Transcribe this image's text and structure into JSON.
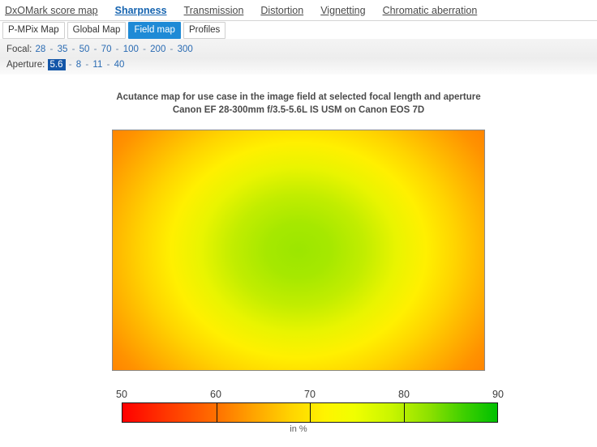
{
  "top_nav": {
    "items": [
      {
        "label": "DxOMark score map",
        "active": false
      },
      {
        "label": "Sharpness",
        "active": true
      },
      {
        "label": "Transmission",
        "active": false
      },
      {
        "label": "Distortion",
        "active": false
      },
      {
        "label": "Vignetting",
        "active": false
      },
      {
        "label": "Chromatic aberration",
        "active": false
      }
    ]
  },
  "subtabs": {
    "items": [
      {
        "label": "P-MPix Map",
        "selected": false
      },
      {
        "label": "Global Map",
        "selected": false
      },
      {
        "label": "Field map",
        "selected": true
      },
      {
        "label": "Profiles",
        "selected": false
      }
    ]
  },
  "parameters": {
    "focal": {
      "label": "Focal:",
      "values": [
        "28",
        "35",
        "50",
        "70",
        "100",
        "200",
        "300"
      ],
      "selected": null
    },
    "aperture": {
      "label": "Aperture:",
      "values": [
        "5.6",
        "8",
        "11",
        "40"
      ],
      "selected": "5.6"
    },
    "separator": "-"
  },
  "chart": {
    "title_line1": "Acutance map for use case in the image field at selected focal length and aperture",
    "title_line2": "Canon EF 28-300mm f/3.5-5.6L IS USM on Canon EOS 7D",
    "unit_label": "in %"
  },
  "colors": {
    "accent_blue": "#1e8ad6",
    "link_blue": "#2a6bb3",
    "selected_blue": "#1356a8",
    "scale_low": "#ff0000",
    "scale_mid": "#fff400",
    "scale_high": "#00c000"
  },
  "chart_data": {
    "type": "heatmap",
    "title": "Acutance map for use case in the image field at selected focal length and aperture",
    "subtitle": "Canon EF 28-300mm f/3.5-5.6L IS USM on Canon EOS 7D",
    "xlabel": "",
    "ylabel": "",
    "unit": "%",
    "colorbar": {
      "label": "in %",
      "min": 50,
      "max": 90,
      "ticks": [
        50,
        60,
        70,
        80,
        90
      ],
      "tick_labels": [
        "50",
        "60",
        "70",
        "80",
        "90"
      ],
      "stops": [
        {
          "value": 50,
          "color": "#ff0000"
        },
        {
          "value": 60,
          "color": "#ff9000"
        },
        {
          "value": 70,
          "color": "#fff400"
        },
        {
          "value": 80,
          "color": "#8ce000"
        },
        {
          "value": 90,
          "color": "#00c000"
        }
      ]
    },
    "field_shape": "radial",
    "center_value": 79,
    "edge_value": 68,
    "corner_value": 63,
    "grid": false,
    "legend_position": "bottom",
    "sampled_values": {
      "center": 79,
      "top_center": 70,
      "bottom_center": 70,
      "left_center": 69,
      "right_center": 69,
      "top_left_corner": 63,
      "top_right_corner": 63,
      "bottom_left_corner": 63,
      "bottom_right_corner": 63
    }
  }
}
